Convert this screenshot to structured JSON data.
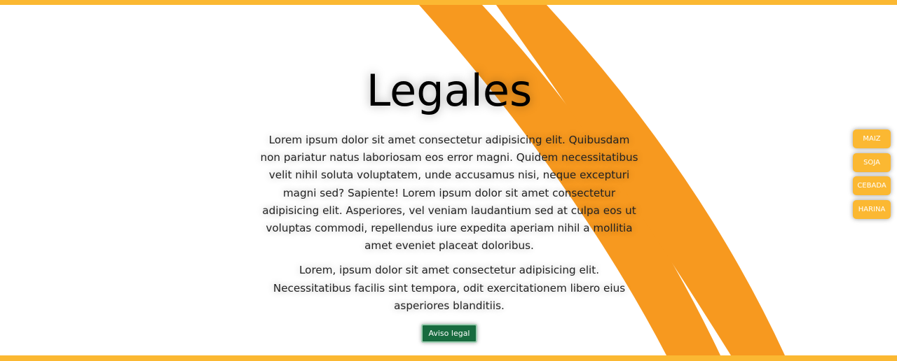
{
  "page": {
    "title": "Legales",
    "paragraphs": [
      "Lorem ipsum dolor sit amet consectetur adipisicing elit. Quibusdam non pariatur natus laboriosam eos error magni. Quidem necessitatibus velit nihil soluta voluptatem, unde accusamus nisi, neque excepturi magni sed? Sapiente! Lorem ipsum dolor sit amet consectetur adipisicing elit. Asperiores, vel veniam laudantium sed at culpa eos ut voluptas commodi, repellendus iure expedita aperiam nihil a mollitia amet eveniet placeat doloribus.",
      "Lorem, ipsum dolor sit amet consectetur adipisicing elit. Necessitatibus facilis sint tempora, odit exercitationem libero eius asperiores blanditiis."
    ],
    "legal_button_label": "Aviso legal"
  },
  "side_nav": {
    "items": [
      {
        "label": "MAIZ"
      },
      {
        "label": "SOJA"
      },
      {
        "label": "CEBADA"
      },
      {
        "label": "HARINA"
      }
    ]
  },
  "colors": {
    "accent": "#fbb832",
    "stripe": "#f7991f",
    "button_green": "#186b3f",
    "background": "#ffffff"
  }
}
